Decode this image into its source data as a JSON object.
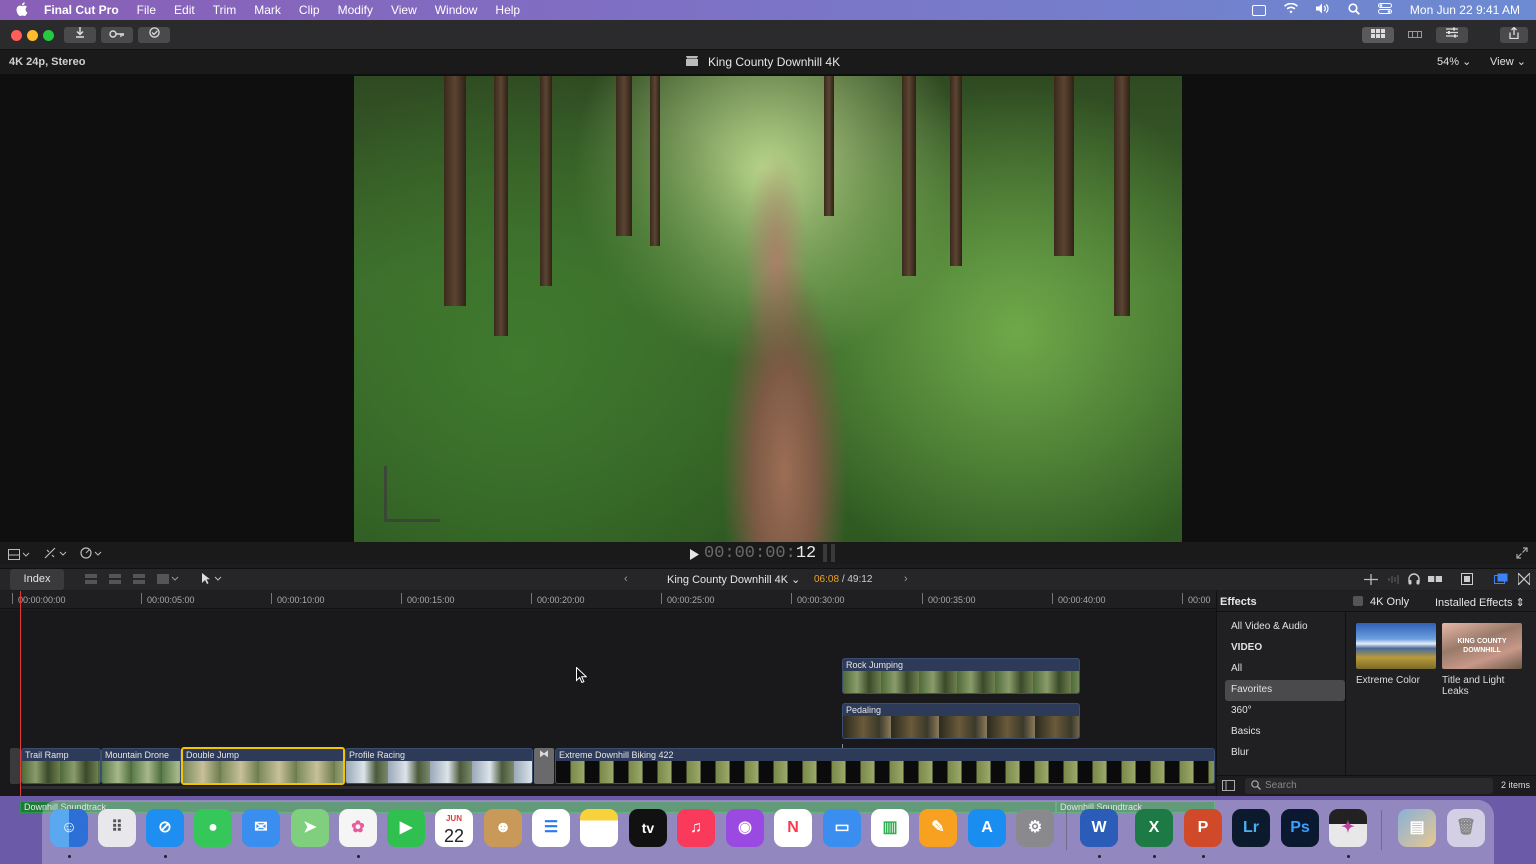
{
  "menubar": {
    "apple": "",
    "items": [
      "Final Cut Pro",
      "File",
      "Edit",
      "Trim",
      "Mark",
      "Clip",
      "Modify",
      "View",
      "Window",
      "Help"
    ],
    "datetime": "Mon Jun 22  9:41 AM"
  },
  "viewer": {
    "format": "4K 24p, Stereo",
    "title": "King County Downhill 4K",
    "zoom": "54%",
    "view_label": "View",
    "timecode_dim": "00:00:00:",
    "timecode_frames": "12"
  },
  "timeline_bar": {
    "index_label": "Index",
    "project": "King County Downhill 4K",
    "position": "06:08",
    "duration": "/ 49:12"
  },
  "ruler": [
    "00:00:00:00",
    "00:00:05:00",
    "00:00:10:00",
    "00:00:15:00",
    "00:00:20:00",
    "00:00:25:00",
    "00:00:30:00",
    "00:00:35:00",
    "00:00:40:00",
    "00:00"
  ],
  "clips": {
    "connected": [
      "Rock Jumping",
      "Pedaling"
    ],
    "primary": [
      "Trail Ramp",
      "Mountain Drone",
      "Double Jump",
      "Profile Racing",
      "Extreme Downhill Biking 422"
    ],
    "audio": [
      "Downhill Soundtrack",
      "Downhill Soundtrack"
    ]
  },
  "effects": {
    "header": "Effects",
    "filter_label": "4K Only",
    "source": "Installed Effects",
    "categories": [
      "All Video & Audio",
      "VIDEO",
      "All",
      "Favorites",
      "360°",
      "Basics",
      "Blur"
    ],
    "selected_category": "Favorites",
    "items": [
      "Extreme Color",
      "Title and Light Leaks"
    ],
    "thumb_text": "KING COUNTY DOWNHILL",
    "search_placeholder": "Search",
    "count": "2 items"
  },
  "dock": {
    "calendar_month": "JUN",
    "calendar_day": "22",
    "labels": [
      "tv",
      "W",
      "X",
      "P",
      "Lr",
      "Ps"
    ]
  },
  "colors": {
    "playhead": "#e03a3a",
    "selection": "#f5c400",
    "position_accent": "#f0a020"
  }
}
